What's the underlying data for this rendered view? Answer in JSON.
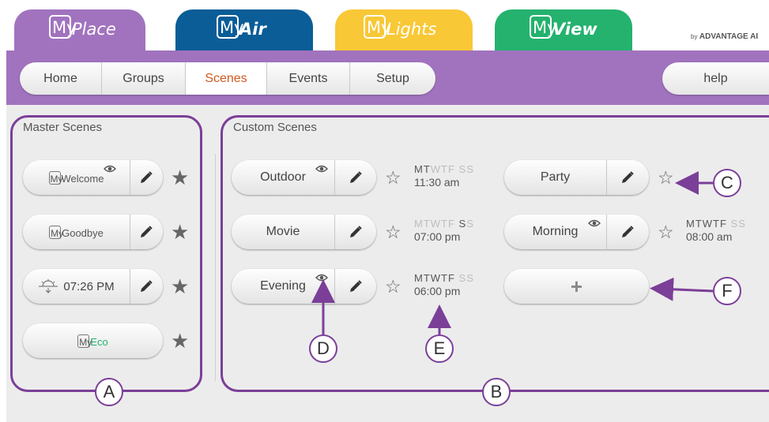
{
  "app_tabs": [
    {
      "my": "My",
      "name": "Place",
      "color": "#a173be"
    },
    {
      "my": "My",
      "name": "Air",
      "color": "#0a5d97"
    },
    {
      "my": "My",
      "name": "Lights",
      "color": "#f8c836"
    },
    {
      "my": "My",
      "name": "View",
      "color": "#24b26e"
    }
  ],
  "brand": {
    "by": "by",
    "name": "ADVANTAGE AI"
  },
  "nav": {
    "items": [
      "Home",
      "Groups",
      "Scenes",
      "Events",
      "Setup"
    ],
    "active": "Scenes",
    "help": "help"
  },
  "master": {
    "title": "Master Scenes",
    "scenes": [
      {
        "my": "My",
        "name": "Welcome",
        "eye": true,
        "starred": true
      },
      {
        "my": "My",
        "name": "Goodbye",
        "eye": false,
        "starred": true
      },
      {
        "time": "07:26 PM",
        "icon": "sunset-icon",
        "starred": true
      },
      {
        "my": "My",
        "name": "Eco",
        "name_color": "#24b26e",
        "starred": true
      }
    ]
  },
  "custom": {
    "title": "Custom Scenes",
    "scenes": [
      {
        "name": "Outdoor",
        "eye": true,
        "days_on": "MT",
        "days_off": "WTF SS",
        "time": "11:30 am"
      },
      {
        "name": "Party",
        "eye": false
      },
      {
        "name": "Movie",
        "eye": false,
        "days_off": "MTWTF",
        "days_on": "S",
        "days_off2": "S",
        "time": "07:00 pm"
      },
      {
        "name": "Morning",
        "eye": true,
        "days_on": "MTWTF",
        "days_off": "SS",
        "time": "08:00 am"
      },
      {
        "name": "Evening",
        "eye": true,
        "days_on": "MTWTF",
        "days_off": "SS",
        "time": "06:00 pm"
      }
    ],
    "add_label": "+"
  },
  "callouts": {
    "a": "A",
    "b": "B",
    "c": "C",
    "d": "D",
    "e": "E",
    "f": "F"
  },
  "colors": {
    "accent": "#a173be",
    "annotation": "#7b3f98",
    "active_tab": "#d05a1d"
  }
}
